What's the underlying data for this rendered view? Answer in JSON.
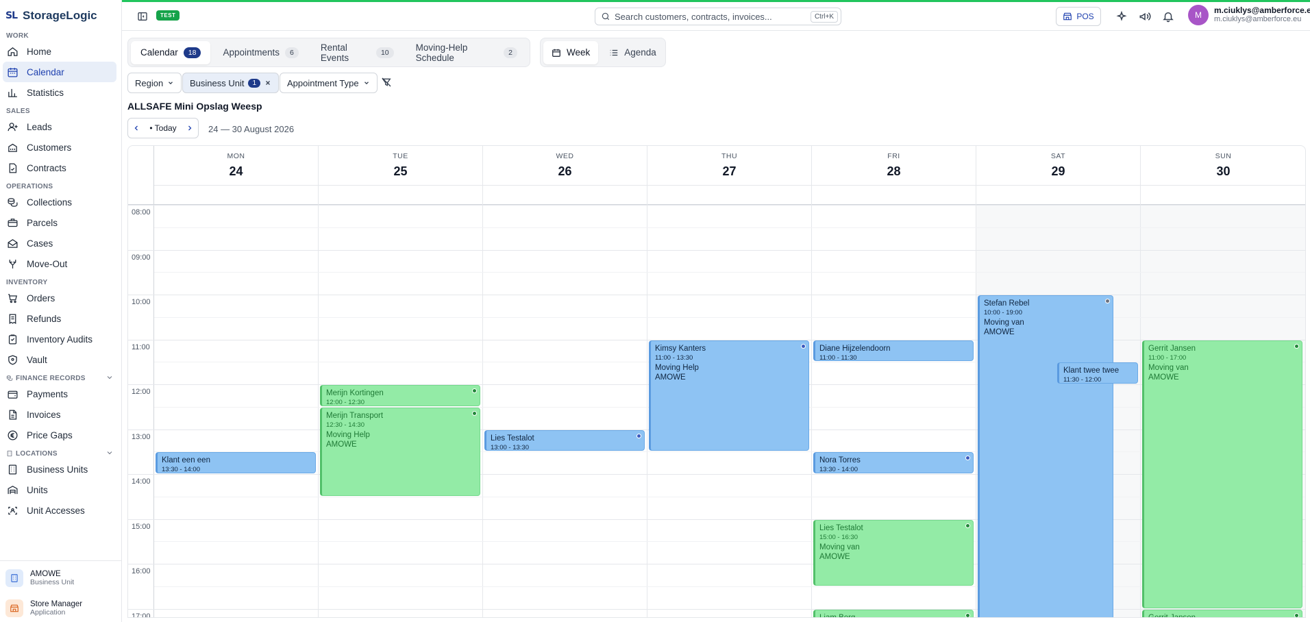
{
  "brand": {
    "logo": "SL",
    "name": "StorageLogic"
  },
  "sidebar": {
    "sections": [
      {
        "title": "WORK",
        "items": [
          {
            "label": "Home",
            "icon": "home-icon"
          },
          {
            "label": "Calendar",
            "icon": "calendar-icon",
            "active": true
          },
          {
            "label": "Statistics",
            "icon": "bar-chart-icon"
          }
        ]
      },
      {
        "title": "SALES",
        "items": [
          {
            "label": "Leads",
            "icon": "user-plus-icon"
          },
          {
            "label": "Customers",
            "icon": "building-icon"
          },
          {
            "label": "Contracts",
            "icon": "file-check-icon"
          }
        ]
      },
      {
        "title": "OPERATIONS",
        "items": [
          {
            "label": "Collections",
            "icon": "coins-icon"
          },
          {
            "label": "Parcels",
            "icon": "package-icon"
          },
          {
            "label": "Cases",
            "icon": "mail-open-icon"
          },
          {
            "label": "Move-Out",
            "icon": "split-icon"
          }
        ]
      },
      {
        "title": "INVENTORY",
        "items": [
          {
            "label": "Orders",
            "icon": "cart-icon"
          },
          {
            "label": "Refunds",
            "icon": "receipt-icon"
          },
          {
            "label": "Inventory Audits",
            "icon": "clipboard-icon"
          },
          {
            "label": "Vault",
            "icon": "shield-icon"
          }
        ]
      },
      {
        "title": "FINANCE RECORDS",
        "collapsible": true,
        "items": [
          {
            "label": "Payments",
            "icon": "wallet-icon"
          },
          {
            "label": "Invoices",
            "icon": "file-icon"
          },
          {
            "label": "Price Gaps",
            "icon": "euro-icon"
          }
        ]
      },
      {
        "title": "LOCATIONS",
        "collapsible": true,
        "items": [
          {
            "label": "Business Units",
            "icon": "office-icon"
          },
          {
            "label": "Units",
            "icon": "warehouse-icon"
          },
          {
            "label": "Unit Accesses",
            "icon": "scan-icon"
          }
        ]
      }
    ],
    "footer": [
      {
        "title": "AMOWE",
        "subtitle": "Business Unit"
      },
      {
        "title": "Store Manager",
        "subtitle": "Application"
      }
    ]
  },
  "topbar": {
    "env_badge": "TEST",
    "search_placeholder": "Search customers, contracts, invoices...",
    "search_shortcut": "Ctrl+K",
    "pos_label": "POS",
    "user": {
      "initial": "M",
      "name": "m.ciuklys@amberforce.eu",
      "email": "m.ciuklys@amberforce.eu"
    }
  },
  "tabs": [
    {
      "label": "Calendar",
      "count": "18",
      "active": true
    },
    {
      "label": "Appointments",
      "count": "6"
    },
    {
      "label": "Rental Events",
      "count": "10"
    },
    {
      "label": "Moving-Help Schedule",
      "count": "2"
    }
  ],
  "views": [
    {
      "label": "Week",
      "active": true
    },
    {
      "label": "Agenda"
    }
  ],
  "filters": {
    "region": "Region",
    "business_unit": "Business Unit",
    "business_unit_count": "1",
    "appointment_type": "Appointment Type"
  },
  "location_title": "ALLSAFE Mini Opslag Weesp",
  "calendar_nav": {
    "today": "• Today",
    "range": "24 — 30 August 2026"
  },
  "colors": {
    "accent": "#1e3a8a",
    "event_blue": "#8ec3f3",
    "event_green": "#93eba6",
    "env_green": "#16a34a"
  },
  "days": [
    {
      "dow": "MON",
      "num": "24"
    },
    {
      "dow": "TUE",
      "num": "25"
    },
    {
      "dow": "WED",
      "num": "26"
    },
    {
      "dow": "THU",
      "num": "27"
    },
    {
      "dow": "FRI",
      "num": "28"
    },
    {
      "dow": "SAT",
      "num": "29",
      "weekend": true
    },
    {
      "dow": "SUN",
      "num": "30",
      "weekend": true
    }
  ],
  "hours": [
    "08:00",
    "09:00",
    "10:00",
    "11:00",
    "12:00",
    "13:00",
    "14:00",
    "15:00",
    "16:00",
    "17:00"
  ],
  "events": [
    {
      "day": 0,
      "start": "13:30",
      "end": "14:00",
      "color": "blue",
      "title": "Klant een een",
      "time": "13:30 - 14:00",
      "lines": []
    },
    {
      "day": 1,
      "start": "12:00",
      "end": "12:30",
      "color": "green",
      "title": "Merijn Kortingen",
      "time": "12:00 - 12:30",
      "lines": [],
      "dot": true
    },
    {
      "day": 1,
      "start": "12:30",
      "end": "14:30",
      "color": "green",
      "title": "Merijn Transport",
      "time": "12:30 - 14:30",
      "lines": [
        "Moving Help",
        "AMOWE"
      ],
      "dot": true
    },
    {
      "day": 2,
      "start": "13:00",
      "end": "13:30",
      "color": "blue",
      "title": "Lies Testalot",
      "time": "13:00 - 13:30",
      "lines": [],
      "dot": true
    },
    {
      "day": 3,
      "start": "11:00",
      "end": "13:30",
      "color": "blue",
      "title": "Kimsy Kanters",
      "time": "11:00 - 13:30",
      "lines": [
        "Moving Help",
        "AMOWE"
      ],
      "dot": true
    },
    {
      "day": 4,
      "start": "11:00",
      "end": "11:30",
      "color": "blue",
      "title": "Diane Hijzelendoorn",
      "time": "11:00 - 11:30",
      "lines": []
    },
    {
      "day": 4,
      "start": "13:30",
      "end": "14:00",
      "color": "blue",
      "title": "Nora Torres",
      "time": "13:30 - 14:00",
      "lines": [],
      "dot": true
    },
    {
      "day": 4,
      "start": "15:00",
      "end": "16:30",
      "color": "green",
      "title": "Lies Testalot",
      "time": "15:00 - 16:30",
      "lines": [
        "Moving van",
        "AMOWE"
      ],
      "dot": true
    },
    {
      "day": 4,
      "start": "17:00",
      "end": "17:30",
      "color": "green",
      "title": "Liam Berg",
      "time": "",
      "lines": [],
      "dot": true
    },
    {
      "day": 5,
      "start": "10:00",
      "end": "19:00",
      "color": "blue",
      "title": "Stefan Rebel",
      "time": "10:00 - 19:00",
      "lines": [
        "Moving van",
        "AMOWE"
      ],
      "dot": true,
      "dim": true,
      "width": "narrow"
    },
    {
      "day": 5,
      "start": "11:30",
      "end": "12:00",
      "color": "blue",
      "title": "Klant twee twee",
      "time": "11:30 - 12:00",
      "lines": [],
      "overlap": true
    },
    {
      "day": 6,
      "start": "11:00",
      "end": "17:00",
      "color": "green",
      "title": "Gerrit Jansen",
      "time": "11:00 - 17:00",
      "lines": [
        "Moving van",
        "AMOWE"
      ],
      "dot": true
    },
    {
      "day": 6,
      "start": "17:00",
      "end": "17:30",
      "color": "green",
      "title": "Gerrit Jansen",
      "time": "",
      "lines": [],
      "dot": true
    }
  ]
}
